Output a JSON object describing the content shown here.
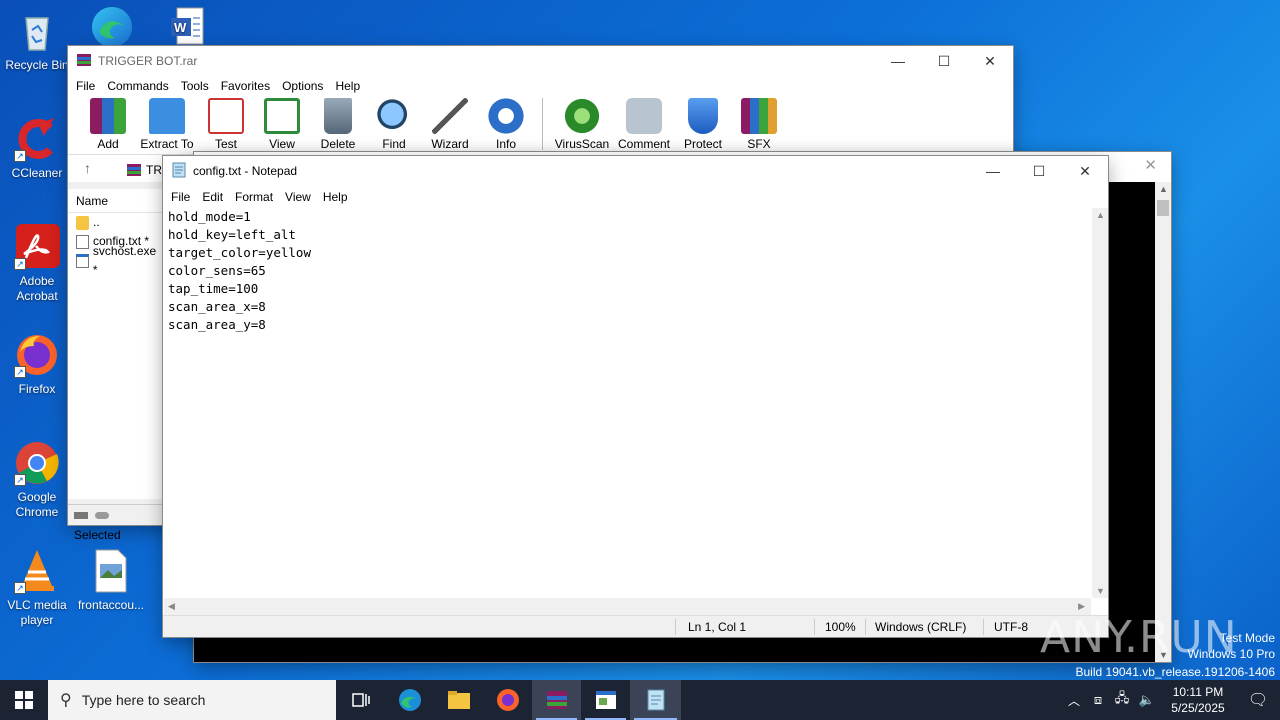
{
  "desktop": {
    "icons": [
      {
        "label": "Recycle Bin"
      },
      {
        "label": "CCleaner"
      },
      {
        "label": "Adobe Acrobat"
      },
      {
        "label": "Firefox"
      },
      {
        "label": "Google Chrome"
      },
      {
        "label": "VLC media player"
      },
      {
        "label": "frontaccou..."
      }
    ]
  },
  "winrar": {
    "title": "TRIGGER BOT.rar",
    "menu": [
      "File",
      "Commands",
      "Tools",
      "Favorites",
      "Options",
      "Help"
    ],
    "toolbar": [
      "Add",
      "Extract To",
      "Test",
      "View",
      "Delete",
      "Find",
      "Wizard",
      "Info",
      "VirusScan",
      "Comment",
      "Protect",
      "SFX"
    ],
    "path_prefix": "TRI",
    "list_header": "Name",
    "files": [
      {
        "name": ".."
      },
      {
        "name": "config.txt *"
      },
      {
        "name": "svchost.exe *"
      }
    ],
    "status": "Selected"
  },
  "notepad": {
    "title": "config.txt - Notepad",
    "menu": [
      "File",
      "Edit",
      "Format",
      "View",
      "Help"
    ],
    "content": "hold_mode=1\nhold_key=left_alt\ntarget_color=yellow\ncolor_sens=65\ntap_time=100\nscan_area_x=8\nscan_area_y=8",
    "status": {
      "position": "Ln 1, Col 1",
      "zoom": "100%",
      "line_ending": "Windows (CRLF)",
      "encoding": "UTF-8"
    }
  },
  "taskbar": {
    "search_placeholder": "Type here to search",
    "time": "10:11 PM",
    "date": "5/25/2025"
  },
  "watermark": {
    "brand": "ANY.RUN",
    "mode": "Test Mode",
    "os": "Windows 10 Pro",
    "build": "Build 19041.vb_release.191206-1406"
  },
  "colors": {
    "desktop_bg": "#0c6fd8",
    "taskbar_bg": "#1c2433",
    "console_bg": "#000000"
  }
}
